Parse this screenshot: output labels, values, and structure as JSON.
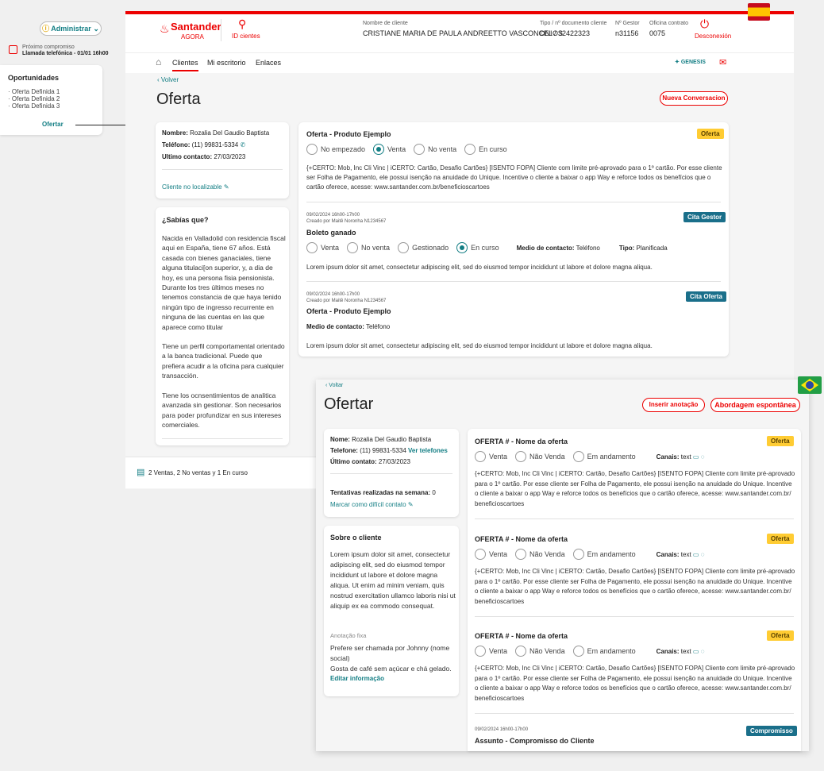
{
  "left_panel": {
    "admin_label": "Administrar",
    "next_label": "Próximo compromiso",
    "next_value": "Llamada telefónica - 01/01 16h00",
    "opps_title": "Oportunidades",
    "opps": [
      "· Oferta Definida 1",
      "· Oferta Definida 2",
      "· Oferta Definida 3"
    ],
    "ofertar": "Ofertar"
  },
  "header": {
    "brand": "Santander",
    "brand_sub": "AGORA",
    "id_clientes": "ID cientes",
    "client_label": "Nombre de cliente",
    "client_value": "CRISTIANE MARIA DE PAULA ANDREETTO VASCONCELOS",
    "doc_label": "Tipo / nº documento cliente",
    "doc_value": "DNI / 32422323",
    "gestor_label": "Nº Gestor",
    "gestor_value": "n31156",
    "oficina_label": "Oficina contrato",
    "oficina_value": "0075",
    "logout": "Desconexión",
    "nav": [
      "Clientes",
      "Mi escritorio",
      "Enlaces"
    ],
    "genesis": "GENESIS"
  },
  "es_page": {
    "back": "Volver",
    "title": "Oferta",
    "new_conv": "Nueva Conversacion",
    "client": {
      "name_label": "Nombre:",
      "name": "Rozalia Del Gaudio Baptista",
      "phone_label": "Teléfono:",
      "phone": "(11) 99831-5334",
      "last_label": "Ultimo contacto:",
      "last": "27/03/2023",
      "not_found": "Cliente no localizable"
    },
    "sabias": {
      "title": "¿Sabías que?",
      "p1": "Nacida en Valladolid con residencia fiscal aqui en España, tiene 67 años. Está casada con bienes ganaciales, tiene alguna titulaci[on superior, y, a dia de hoy, es una persona fisia pensionista. Durante los tres últimos meses no tenemos constancia de que haya tenido ningún tipo de ingresso recurrente en ninguna de las cuentas en las que aparece como titular",
      "p2": "Tiene un perfil comportamental orientado a la banca tradicional. Puede que prefiera acudir a la oficina para cualquier transacción.",
      "p3": "Tiene los ocnsentimientos de analitica avanzada sin gestionar. Son necesarios para poder profundizar en sus intereses comerciales."
    },
    "offer1": {
      "title": "Oferta - Produto Ejemplo",
      "tag": "Oferta",
      "radios": [
        "No empezado",
        "Venta",
        "No venta",
        "En curso"
      ],
      "text": "{+CERTO: Mob, Inc Cli Vinc | iCERTO: Cartão, Desafio Cartões} [ISENTO FOPA] Cliente com limite pré-aprovado para o 1º cartão. Por esse cliente ser Folha de Pagamento, ele possui isenção na anuidade do Unique. Incentive o cliente a baixar o app Way e reforce todos os benefícios que o cartão oferece, acesse: www.santander.com.br/beneficioscartoes"
    },
    "offer2": {
      "date": "09/02/2024 16h00-17h00",
      "created": "Creado por Maitê Noronha N1234567",
      "title": "Boleto ganado",
      "tag": "Cita Gestor",
      "radios": [
        "Venta",
        "No venta",
        "Gestionado",
        "En curso"
      ],
      "medio_label": "Medio de contacto:",
      "medio": "Teléfono",
      "tipo_label": "Tipo:",
      "tipo": "Planificada",
      "text": "Lorem ipsum dolor sit amet, consectetur adipiscing elit, sed do eiusmod tempor incididunt ut labore et dolore magna aliqua."
    },
    "offer3": {
      "date": "09/02/2024 16h00-17h00",
      "created": "Creado por Maitê Noronha N1234567",
      "title": "Oferta - Produto Ejemplo",
      "tag": "Cita Oferta",
      "medio_label": "Medio de contacto:",
      "medio": "Teléfono",
      "text": "Lorem ipsum dolor sit amet, consectetur adipiscing elit, sed do eiusmod tempor incididunt ut labore et dolore magna aliqua."
    },
    "footer": "2 Ventas, 2 No ventas y 1 En curso"
  },
  "br_page": {
    "back": "Voltar",
    "title": "Ofertar",
    "btn1": "Inserir anotação",
    "btn2": "Abordagem espontânea",
    "client": {
      "name_label": "Nome:",
      "name": "Rozalia Del Gaudio Baptista",
      "phone_label": "Telefone:",
      "phone": "(11) 99831-5334",
      "see_phones": "Ver telefones",
      "last_label": "Último contato:",
      "last": "27/03/2023",
      "attempts_label": "Tentativas realizadas na semana:",
      "attempts": "0",
      "mark": "Marcar como difícil contato"
    },
    "sobre": {
      "title": "Sobre o cliente",
      "text": "Lorem ipsum dolor sit amet, consectetur adipiscing elit, sed do eiusmod tempor incididunt ut labore et dolore magna aliqua. Ut enim ad minim veniam, quis nostrud exercitation ullamco laboris nisi ut aliquip ex ea commodo consequat.",
      "fixed_label": "Anotação fixa",
      "fixed1": "Prefere ser chamada por Johnny (nome social)",
      "fixed2": "Gosta de café sem açúcar e chá gelado.",
      "edit": "Editar informação"
    },
    "offers": [
      {
        "title": "OFERTA # - Nome da oferta",
        "tag": "Oferta"
      },
      {
        "title": "OFERTA # - Nome da oferta",
        "tag": "Oferta"
      },
      {
        "title": "OFERTA # - Nome da oferta",
        "tag": "Oferta"
      }
    ],
    "radios": [
      "Venta",
      "Não Venda",
      "Em andamento"
    ],
    "canais_label": "Canais:",
    "canais_value": "text",
    "offer_text": "{+CERTO: Mob, Inc Cli Vinc | iCERTO: Cartão, Desafio Cartões} [ISENTO FOPA] Cliente com limite pré-aprovado para o 1º cartão. Por esse cliente ser Folha de Pagamento, ele possui isenção na anuidade do Unique. Incentive o cliente a baixar o app Way e reforce todos os benefícios que o cartão oferece, acesse: www.santander.com.br/ beneficioscartoes",
    "comp": {
      "date": "09/02/2024 16h00-17h00",
      "title": "Assunto - Compromisso do Cliente",
      "tag": "Compromisso"
    }
  },
  "colors": {
    "red": "#ec0000",
    "teal": "#137e84",
    "yellow": "#ffcc33",
    "blue_tag": "#1a6f8a"
  }
}
